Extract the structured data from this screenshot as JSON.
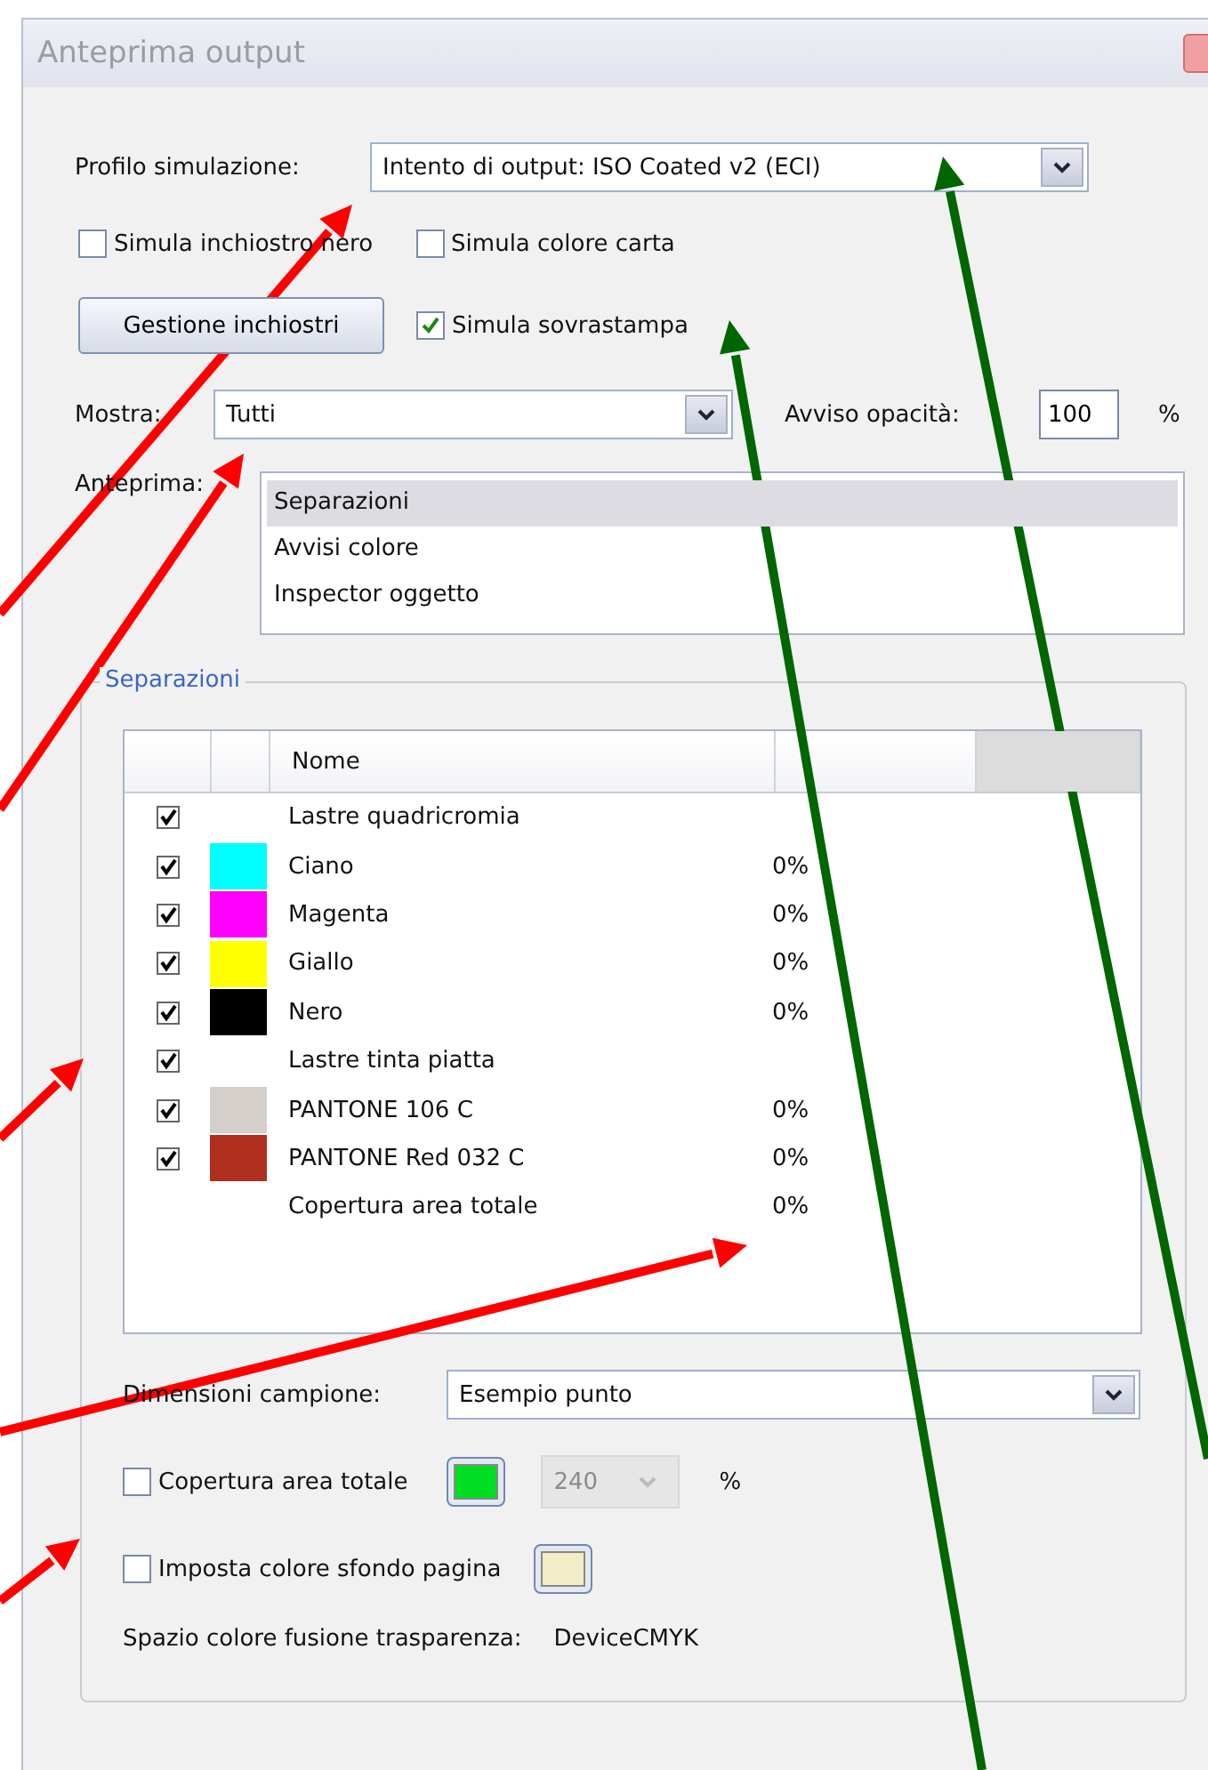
{
  "window": {
    "title": "Anteprima output"
  },
  "simulation_profile": {
    "label": "Profilo simulazione:",
    "value": "Intento di output: ISO Coated v2 (ECI)"
  },
  "options": [
    {
      "label": "Simula inchiostro nero",
      "checked": false
    },
    {
      "label": "Simula colore carta",
      "checked": false
    }
  ],
  "ink_manager_button": "Gestione inchiostri",
  "overprint": {
    "label": "Simula sovrastampa",
    "checked": true
  },
  "show": {
    "label": "Mostra:",
    "value": "Tutti"
  },
  "opacity_warning": {
    "label": "Avviso opacità:",
    "value": "100",
    "unit": "%"
  },
  "preview": {
    "label": "Anteprima:",
    "items": [
      {
        "label": "Separazioni",
        "selected": true
      },
      {
        "label": "Avvisi colore",
        "selected": false
      },
      {
        "label": "Inspector oggetto",
        "selected": false
      }
    ]
  },
  "separations": {
    "title": "Separazioni",
    "table": {
      "columns": [
        "Nome"
      ],
      "rows": [
        {
          "kind": "group",
          "checked": true,
          "name": "Lastre quadricromia"
        },
        {
          "kind": "ink",
          "checked": true,
          "color": "#00ffff",
          "name": "Ciano",
          "coverage": "0%"
        },
        {
          "kind": "ink",
          "checked": true,
          "color": "#ff00ff",
          "name": "Magenta",
          "coverage": "0%"
        },
        {
          "kind": "ink",
          "checked": true,
          "color": "#ffff00",
          "name": "Giallo",
          "coverage": "0%"
        },
        {
          "kind": "ink",
          "checked": true,
          "color": "#000000",
          "name": "Nero",
          "coverage": "0%"
        },
        {
          "kind": "group",
          "checked": true,
          "name": "Lastre tinta piatta"
        },
        {
          "kind": "ink",
          "checked": true,
          "color": "#d4cfca",
          "name": "PANTONE 106 C",
          "coverage": "0%"
        },
        {
          "kind": "ink",
          "checked": true,
          "color": "#b03020",
          "name": "PANTONE Red 032 C",
          "coverage": "0%"
        },
        {
          "kind": "total",
          "name": "Copertura area totale",
          "coverage": "0%"
        }
      ]
    },
    "sample_size": {
      "label": "Dimensioni campione:",
      "value": "Esempio punto"
    },
    "total_coverage": {
      "label": "Copertura area totale",
      "checked": false,
      "color": "#00dd22",
      "value": "240",
      "disabled": true,
      "unit": "%"
    },
    "page_background": {
      "label": "Imposta colore sfondo pagina",
      "checked": false,
      "color": "#f2ecc8"
    },
    "blending_space": {
      "label": "Spazio colore fusione trasparenza:",
      "value": "DeviceCMYK"
    }
  },
  "annotation_arrows": [
    {
      "color": "#ff0000"
    },
    {
      "color": "#ff0000"
    },
    {
      "color": "#ff0000"
    },
    {
      "color": "#ff0000"
    },
    {
      "color": "#ff0000"
    },
    {
      "color": "#006600"
    },
    {
      "color": "#006600"
    }
  ]
}
